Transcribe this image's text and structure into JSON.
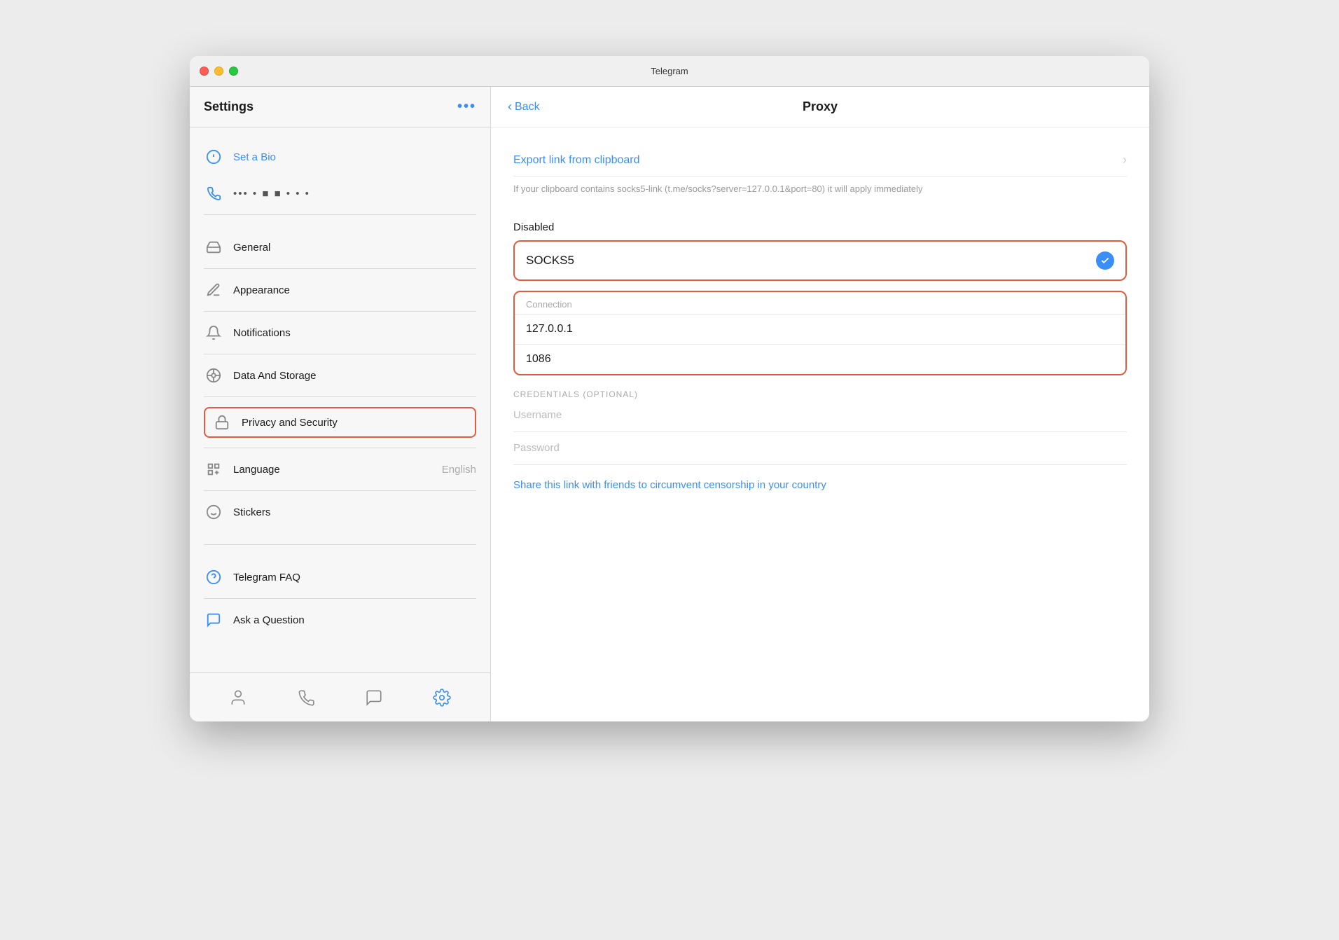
{
  "window": {
    "title": "Telegram"
  },
  "sidebar": {
    "title": "Settings",
    "more_button": "•••",
    "profile": {
      "set_bio_label": "Set a Bio",
      "phone_placeholder": "•••  • ■ ■ •  • •"
    },
    "items": [
      {
        "id": "general",
        "label": "General",
        "icon": "general-icon",
        "value": ""
      },
      {
        "id": "appearance",
        "label": "Appearance",
        "icon": "appearance-icon",
        "value": ""
      },
      {
        "id": "notifications",
        "label": "Notifications",
        "icon": "notifications-icon",
        "value": ""
      },
      {
        "id": "data-storage",
        "label": "Data And Storage",
        "icon": "data-icon",
        "value": ""
      },
      {
        "id": "privacy-security",
        "label": "Privacy and Security",
        "icon": "privacy-icon",
        "value": "",
        "active": true
      },
      {
        "id": "language",
        "label": "Language",
        "icon": "language-icon",
        "value": "English"
      },
      {
        "id": "stickers",
        "label": "Stickers",
        "icon": "stickers-icon",
        "value": ""
      }
    ],
    "help_items": [
      {
        "id": "faq",
        "label": "Telegram FAQ",
        "icon": "faq-icon"
      },
      {
        "id": "ask",
        "label": "Ask a Question",
        "icon": "ask-icon"
      }
    ],
    "bottom_nav": [
      {
        "id": "contacts",
        "icon": "contacts-icon",
        "active": false
      },
      {
        "id": "calls",
        "icon": "calls-icon",
        "active": false
      },
      {
        "id": "chats",
        "icon": "chats-icon",
        "active": false
      },
      {
        "id": "settings",
        "icon": "settings-icon",
        "active": true
      }
    ]
  },
  "main": {
    "back_label": "Back",
    "title": "Proxy",
    "export_link_label": "Export link from clipboard",
    "export_link_desc": "If your clipboard contains socks5-link (t.me/socks?server=127.0.0.1&port=80) it will apply immediately",
    "disabled_label": "Disabled",
    "proxy_type": "SOCKS5",
    "connection_label": "Connection",
    "server_value": "127.0.0.1",
    "port_value": "1086",
    "credentials_label": "CREDENTIALS (OPTIONAL)",
    "username_placeholder": "Username",
    "password_placeholder": "Password",
    "share_link_label": "Share this link with friends to circumvent censorship in your country"
  },
  "colors": {
    "blue": "#3a8ef6",
    "orange_border": "#e05c40",
    "gray_text": "#999999",
    "dark_text": "#1a1a1a"
  }
}
